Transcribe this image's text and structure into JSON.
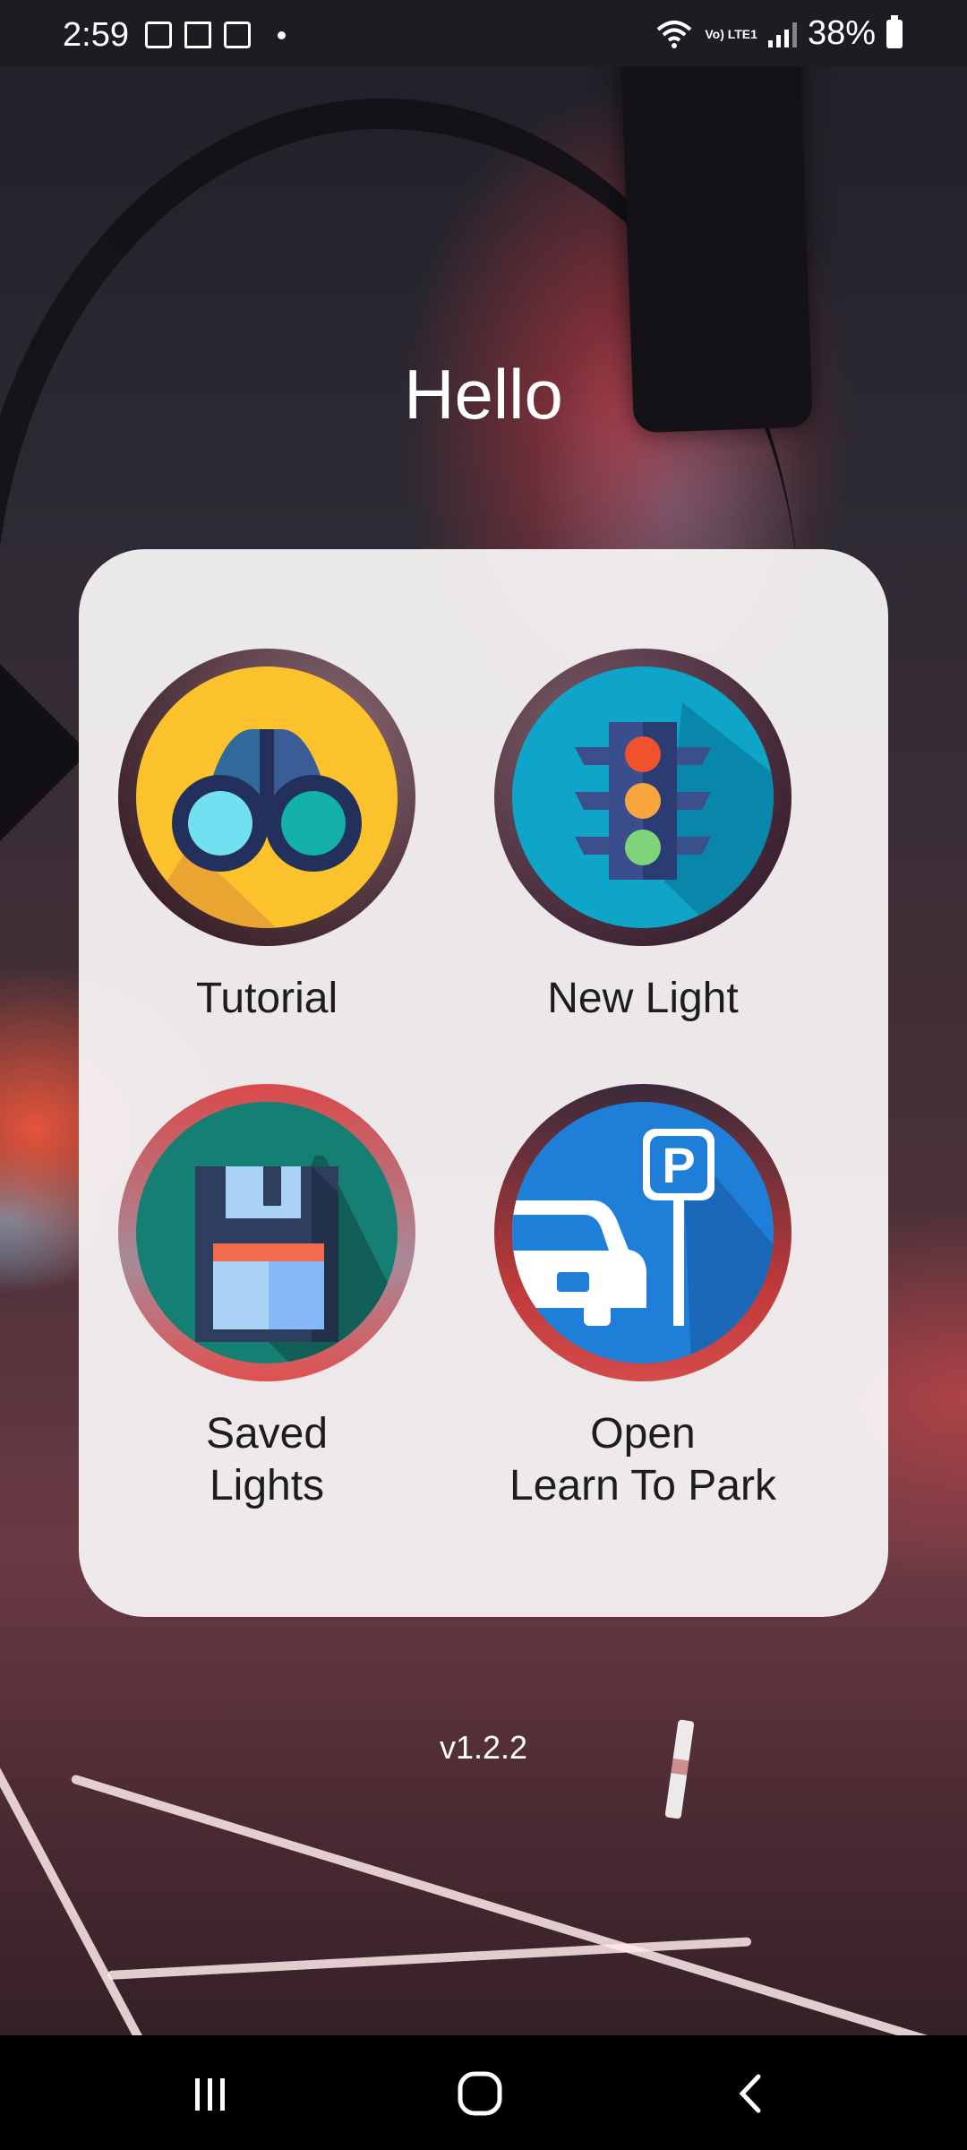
{
  "status_bar": {
    "time": "2:59",
    "network_label": "Vo) LTE1",
    "battery_percent": "38%",
    "icons": [
      "gallery-icon",
      "device-icon",
      "calendar-icon",
      "notification-dot-icon",
      "wifi-icon",
      "signal-icon",
      "battery-icon"
    ]
  },
  "header": {
    "greeting": "Hello"
  },
  "menu": {
    "tiles": [
      {
        "label": "Tutorial",
        "icon": "binoculars-icon"
      },
      {
        "label": "New Light",
        "icon": "traffic-light-icon"
      },
      {
        "label": "Saved\nLights",
        "icon": "floppy-disk-icon"
      },
      {
        "label": "Open\nLearn To Park",
        "icon": "parking-icon"
      }
    ]
  },
  "footer": {
    "version": "v1.2.2"
  },
  "nav_bar": {
    "buttons": [
      "recents-button",
      "home-button",
      "back-button"
    ]
  },
  "colors": {
    "card": "#f5f2f3",
    "yellow": "#fbc22b",
    "teal_blue": "#0fa5c8",
    "green": "#157f73",
    "blue": "#1f7fd8"
  }
}
